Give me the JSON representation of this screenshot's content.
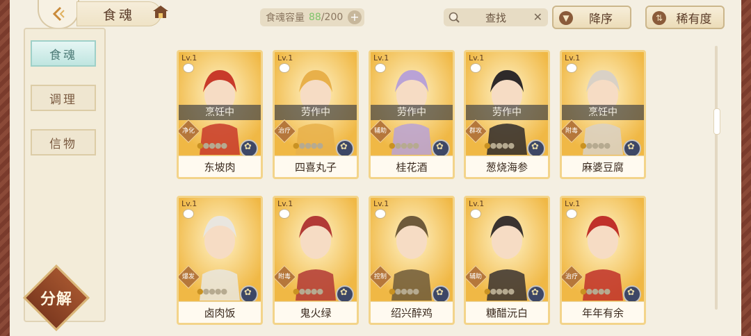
{
  "header": {
    "title": "食魂",
    "capacity_label": "食魂容量",
    "capacity_current": "88",
    "capacity_max": "/200",
    "add_label": "+",
    "search_label": "查找",
    "clear_label": "✕",
    "sort_label": "降序",
    "rarity_label": "稀有度"
  },
  "sidebar": {
    "items": [
      {
        "label": "食魂"
      },
      {
        "label": "调理"
      },
      {
        "label": "信物"
      }
    ],
    "decompose_label": "分解"
  },
  "cards": [
    {
      "level": "Lv.1",
      "status": "烹饪中",
      "role": "净化",
      "name": "东坡肉",
      "palette": "#c83a2a",
      "stars_filled": 1,
      "stars_total": 5
    },
    {
      "level": "Lv.1",
      "status": "劳作中",
      "role": "治疗",
      "name": "四喜丸子",
      "palette": "#e8b04a",
      "stars_filled": 1,
      "stars_total": 5
    },
    {
      "level": "Lv.1",
      "status": "劳作中",
      "role": "辅助",
      "name": "桂花酒",
      "palette": "#b9a2d6",
      "stars_filled": 1,
      "stars_total": 5
    },
    {
      "level": "Lv.1",
      "status": "劳作中",
      "role": "群攻",
      "name": "葱烧海参",
      "palette": "#2f2a2a",
      "stars_filled": 1,
      "stars_total": 5
    },
    {
      "level": "Lv.1",
      "status": "烹饪中",
      "role": "附毒",
      "name": "麻婆豆腐",
      "palette": "#d9d1c6",
      "stars_filled": 1,
      "stars_total": 5
    },
    {
      "level": "Lv.1",
      "status": "",
      "role": "爆发",
      "name": "卤肉饭",
      "palette": "#e9e6df",
      "stars_filled": 1,
      "stars_total": 5
    },
    {
      "level": "Lv.1",
      "status": "",
      "role": "附毒",
      "name": "鬼火绿",
      "palette": "#b23a36",
      "stars_filled": 1,
      "stars_total": 5
    },
    {
      "level": "Lv.1",
      "status": "",
      "role": "控制",
      "name": "绍兴醉鸡",
      "palette": "#6e5a3a",
      "stars_filled": 1,
      "stars_total": 5
    },
    {
      "level": "Lv.1",
      "status": "",
      "role": "辅助",
      "name": "糖醋沅白",
      "palette": "#3a3330",
      "stars_filled": 1,
      "stars_total": 5
    },
    {
      "level": "Lv.1",
      "status": "",
      "role": "治疗",
      "name": "年年有余",
      "palette": "#c0312a",
      "stars_filled": 1,
      "stars_total": 5
    }
  ]
}
